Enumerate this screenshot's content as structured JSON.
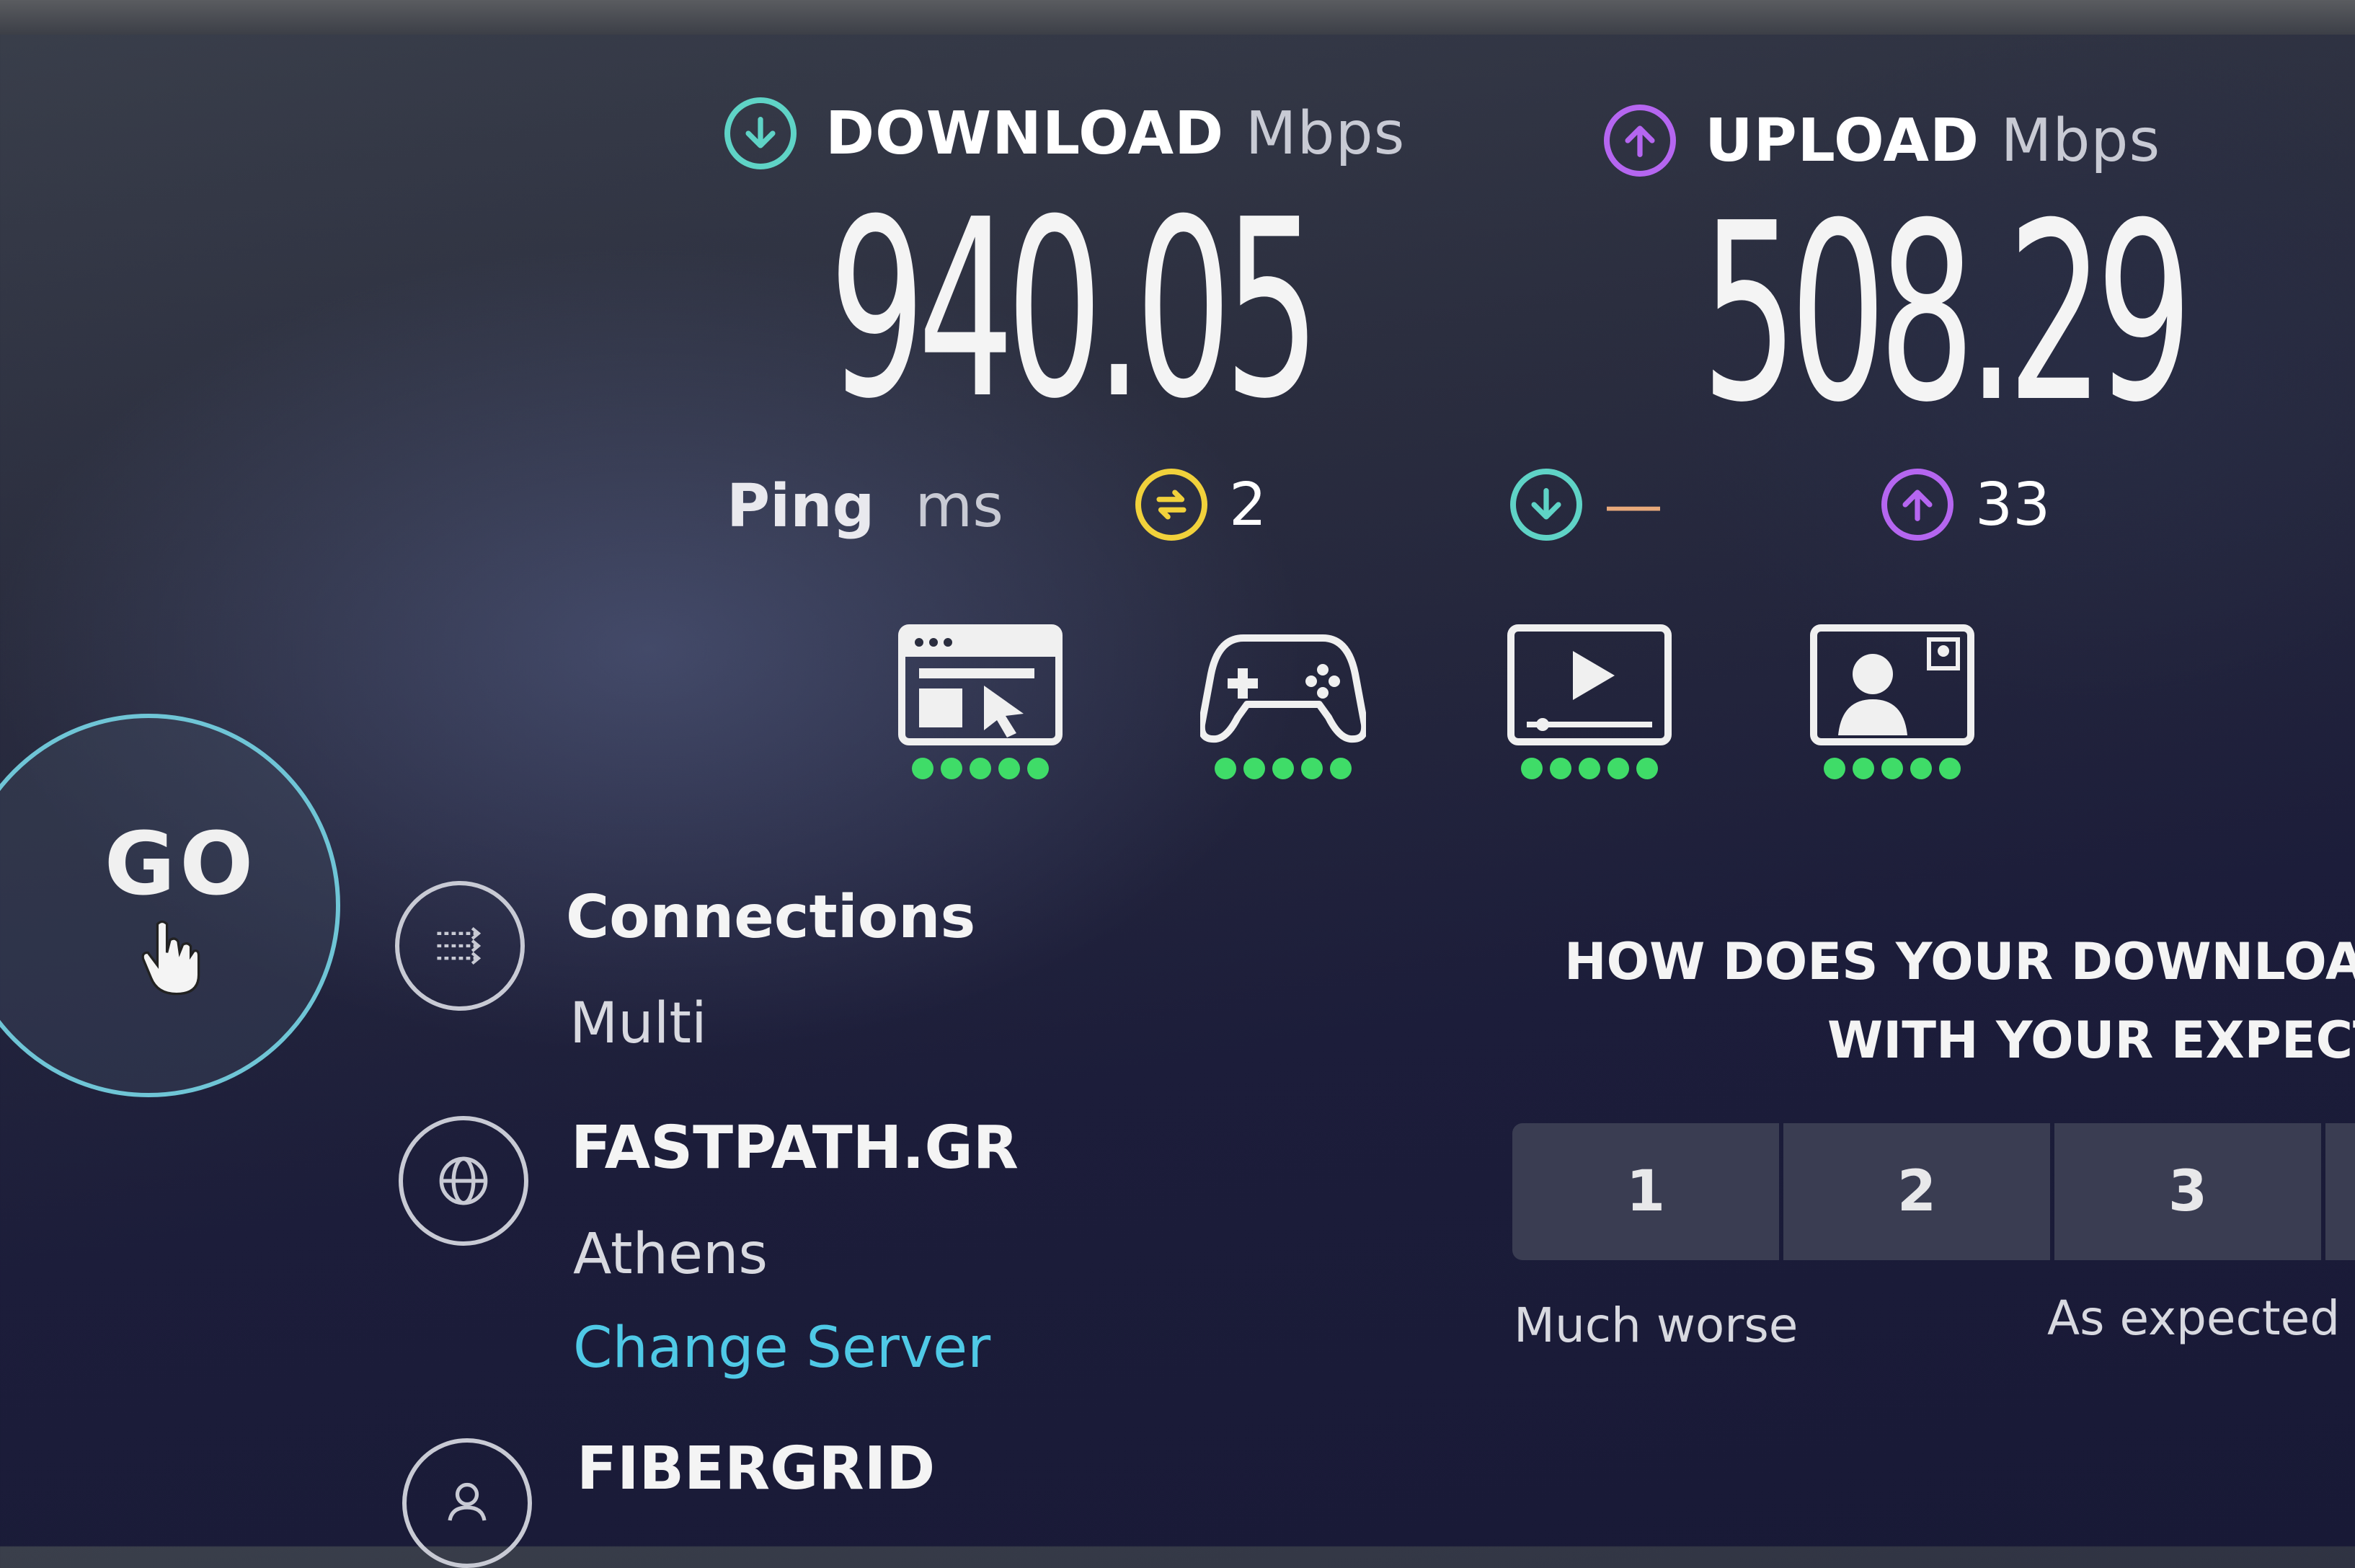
{
  "download": {
    "label": "DOWNLOAD",
    "unit": "Mbps",
    "value": "940.05",
    "icon": "arrow-down-circle-icon",
    "color": "#5fd3c6"
  },
  "upload": {
    "label": "UPLOAD",
    "unit": "Mbps",
    "value": "508.29",
    "icon": "arrow-up-circle-icon",
    "color": "#b566f0"
  },
  "ping": {
    "label": "Ping",
    "unit": "ms",
    "idle": {
      "value": "2",
      "color": "#f1d13b"
    },
    "download": {
      "value": "—",
      "dash_color": "#e8a97a"
    },
    "upload": {
      "value": "33"
    }
  },
  "apps": [
    {
      "name": "web-browsing",
      "icon": "browser-window-icon",
      "rating": 5
    },
    {
      "name": "gaming",
      "icon": "game-controller-icon",
      "rating": 5
    },
    {
      "name": "video-streaming",
      "icon": "video-player-icon",
      "rating": 5
    },
    {
      "name": "video-chat",
      "icon": "video-call-icon",
      "rating": 5
    }
  ],
  "go_button": {
    "label": "GO"
  },
  "connections": {
    "title": "Connections",
    "value": "Multi"
  },
  "server": {
    "title": "FASTPATH.GR",
    "location": "Athens",
    "change_link": "Change Server"
  },
  "provider": {
    "title": "FIBERGRID"
  },
  "survey": {
    "question_line1": "HOW DOES YOUR DOWNLOAD",
    "question_line2": "WITH YOUR EXPECTA",
    "options": [
      "1",
      "2",
      "3"
    ],
    "label_low": "Much worse",
    "label_mid": "As expected"
  }
}
